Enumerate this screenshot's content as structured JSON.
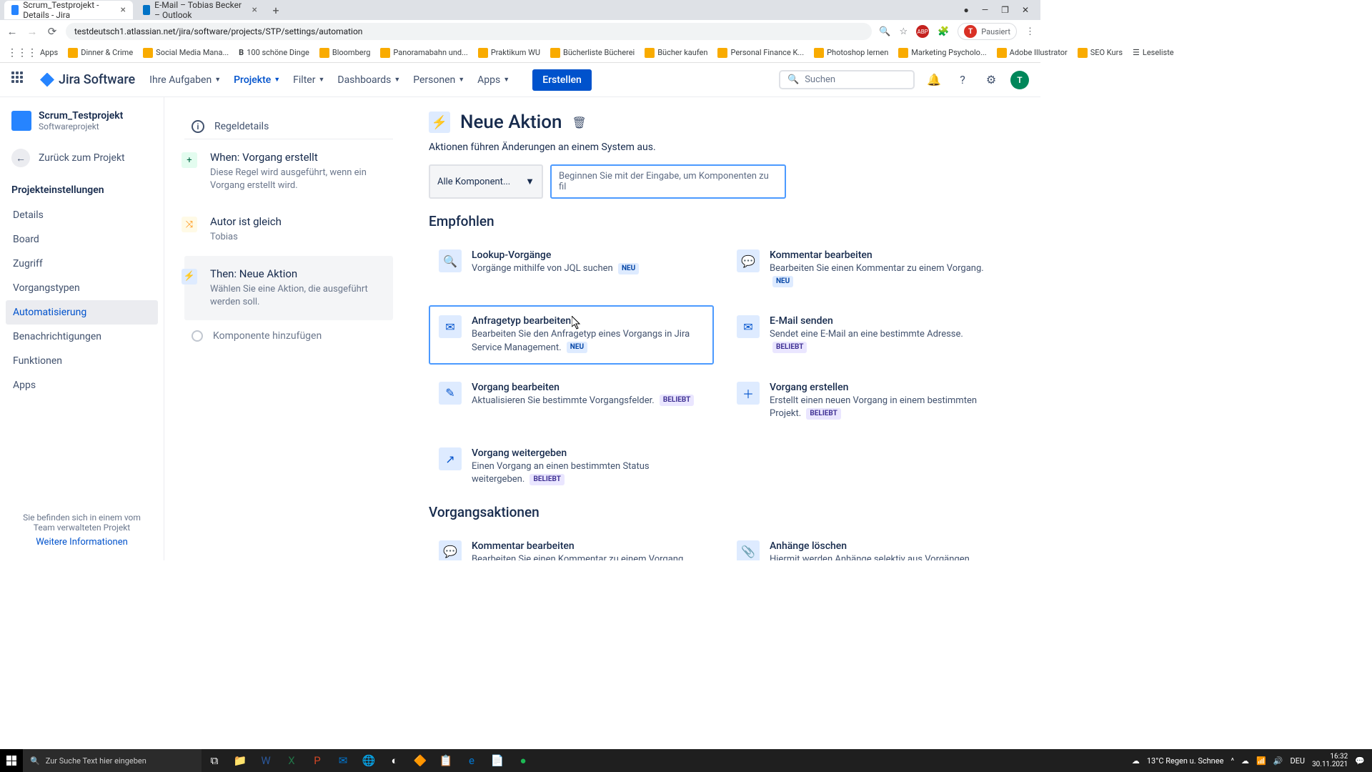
{
  "browser": {
    "tabs": [
      {
        "title": "Scrum_Testprojekt - Details - Jira",
        "active": true
      },
      {
        "title": "E-Mail – Tobias Becker – Outlook",
        "active": false
      }
    ],
    "url": "testdeutsch1.atlassian.net/jira/software/projects/STP/settings/automation",
    "pausiert": "Pausiert",
    "bookmarks": [
      "Apps",
      "Dinner & Crime",
      "Social Media Mana...",
      "100 schöne Dinge",
      "Bloomberg",
      "Panoramabahn und...",
      "Praktikum WU",
      "Bücherliste Bücherei",
      "Bücher kaufen",
      "Personal Finance K...",
      "Photoshop lernen",
      "Marketing Psycholo...",
      "Adobe Illustrator",
      "SEO Kurs"
    ],
    "leseliste": "Leseliste"
  },
  "header": {
    "product": "Jira Software",
    "nav": [
      "Ihre Aufgaben",
      "Projekte",
      "Filter",
      "Dashboards",
      "Personen",
      "Apps"
    ],
    "create": "Erstellen",
    "search_placeholder": "Suchen",
    "avatar": "T"
  },
  "sidebar": {
    "project_name": "Scrum_Testprojekt",
    "project_type": "Softwareprojekt",
    "back": "Zurück zum Projekt",
    "section": "Projekteinstellungen",
    "items": [
      "Details",
      "Board",
      "Zugriff",
      "Vorgangstypen",
      "Automatisierung",
      "Benachrichtigungen",
      "Funktionen",
      "Apps"
    ],
    "active_index": 4,
    "footer1": "Sie befinden sich in einem vom Team verwalteten Projekt",
    "footer2": "Weitere Informationen"
  },
  "rule": {
    "details_label": "Regeldetails",
    "steps": [
      {
        "badge": "+",
        "title": "When: Vorgang erstellt",
        "desc": "Diese Regel wird ausgeführt, wenn ein Vorgang erstellt wird."
      },
      {
        "badge": "⤬",
        "title": "Autor ist gleich",
        "desc": "Tobias"
      },
      {
        "badge": "⚡",
        "title": "Then: Neue Aktion",
        "desc": "Wählen Sie eine Aktion, die ausgeführt werden soll."
      }
    ],
    "add_component": "Komponente hinzufügen"
  },
  "action": {
    "title": "Neue Aktion",
    "subtitle": "Aktionen führen Änderungen an einem System aus.",
    "select_label": "Alle Komponent...",
    "filter_placeholder": "Beginnen Sie mit der Eingabe, um Komponenten zu fil",
    "section_recommended": "Empfohlen",
    "section_issue_actions": "Vorgangsaktionen",
    "tags": {
      "neu": "NEU",
      "beliebt": "BELIEBT"
    },
    "cards_recommended": [
      {
        "icon": "🔍",
        "title": "Lookup-Vorgänge",
        "desc": "Vorgänge mithilfe von JQL suchen",
        "tag": "neu"
      },
      {
        "icon": "💬",
        "title": "Kommentar bearbeiten",
        "desc": "Bearbeiten Sie einen Kommentar zu einem Vorgang.",
        "tag": "neu"
      },
      {
        "icon": "✉",
        "title": "Anfragetyp bearbeiten",
        "desc": "Bearbeiten Sie den Anfragetyp eines Vorgangs in Jira Service Management.",
        "tag": "neu",
        "highlighted": true
      },
      {
        "icon": "✉",
        "title": "E-Mail senden",
        "desc": "Sendet eine E-Mail an eine bestimmte Adresse.",
        "tag": "beliebt"
      },
      {
        "icon": "✎",
        "title": "Vorgang bearbeiten",
        "desc": "Aktualisieren Sie bestimmte Vorgangsfelder.",
        "tag": "beliebt"
      },
      {
        "icon": "＋",
        "title": "Vorgang erstellen",
        "desc": "Erstellt einen neuen Vorgang in einem bestimmten Projekt.",
        "tag": "beliebt"
      },
      {
        "icon": "↗",
        "title": "Vorgang weitergeben",
        "desc": "Einen Vorgang an einen bestimmten Status weitergeben.",
        "tag": "beliebt"
      }
    ],
    "cards_issue": [
      {
        "icon": "💬",
        "title": "Kommentar bearbeiten",
        "desc": "Bearbeiten Sie einen Kommentar zu einem Vorgang."
      },
      {
        "icon": "📎",
        "title": "Anhänge löschen",
        "desc": "Hiermit werden Anhänge selektiv aus Vorgängen gelöscht."
      }
    ]
  },
  "taskbar": {
    "search": "Zur Suche Text hier eingeben",
    "weather": "13°C  Regen u. Schnee",
    "lang": "DEU",
    "time": "16:32",
    "date": "30.11.2021"
  }
}
